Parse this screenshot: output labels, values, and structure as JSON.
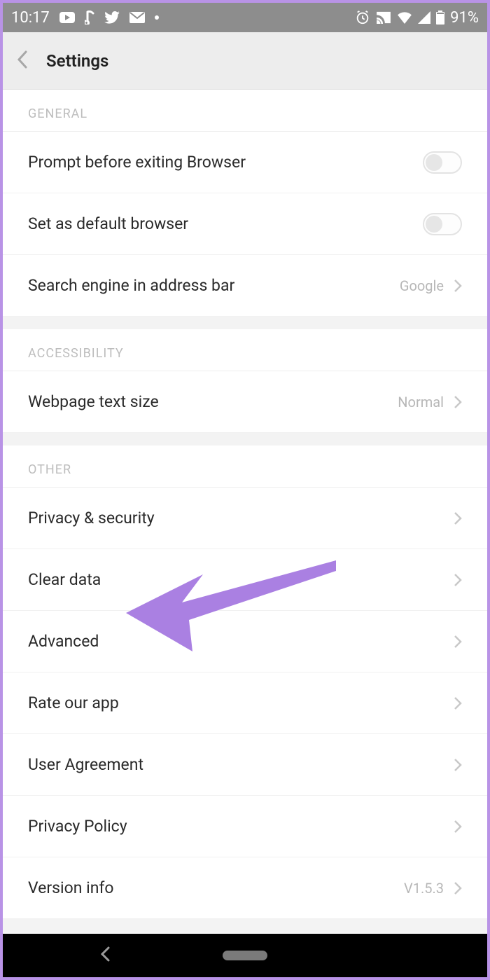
{
  "status": {
    "time": "10:17",
    "battery": "91%"
  },
  "header": {
    "title": "Settings"
  },
  "sections": {
    "general": {
      "label": "GENERAL",
      "rows": {
        "prompt_exit": "Prompt before exiting Browser",
        "default_browser": "Set as default browser",
        "search_engine": "Search engine in address bar",
        "search_engine_value": "Google"
      }
    },
    "accessibility": {
      "label": "ACCESSIBILITY",
      "rows": {
        "text_size": "Webpage text size",
        "text_size_value": "Normal"
      }
    },
    "other": {
      "label": "OTHER",
      "rows": {
        "privacy_security": "Privacy & security",
        "clear_data": "Clear data",
        "advanced": "Advanced",
        "rate_app": "Rate our app",
        "user_agreement": "User Agreement",
        "privacy_policy": "Privacy Policy",
        "version_info": "Version info",
        "version_value": "V1.5.3"
      }
    }
  }
}
